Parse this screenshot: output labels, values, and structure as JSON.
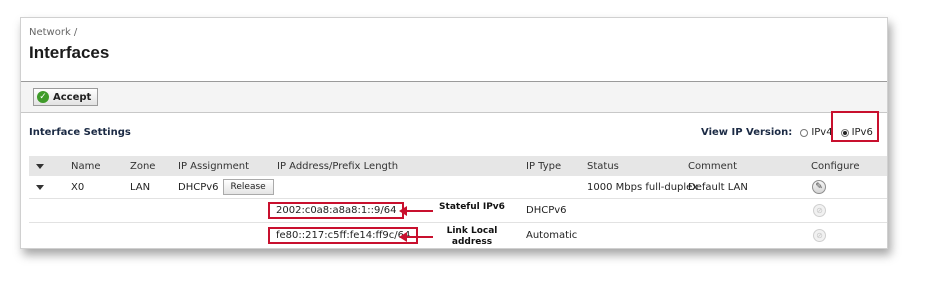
{
  "breadcrumb": "Network /",
  "title": "Interfaces",
  "toolbar": {
    "accept_label": "Accept"
  },
  "section_title": "Interface Settings",
  "ip_version": {
    "label": "View IP Version:",
    "options": [
      "IPv4",
      "IPv6"
    ],
    "selected": "IPv6"
  },
  "table": {
    "headers": [
      "Name",
      "Zone",
      "IP Assignment",
      "IP Address/Prefix Length",
      "IP Type",
      "Status",
      "Comment",
      "Configure"
    ],
    "interface_row": {
      "name": "X0",
      "zone": "LAN",
      "ip_assignment": "DHCPv6",
      "release_label": "Release",
      "status": "1000 Mbps full-duplex",
      "comment": "Default LAN"
    },
    "address_rows": [
      {
        "address": "2002:c0a8:a8a8:1::9/64",
        "ip_type": "DHCPv6"
      },
      {
        "address": "fe80::217:c5ff:fe14:ff9c/64",
        "ip_type": "Automatic"
      }
    ]
  },
  "annotations": {
    "stateful": "Stateful IPv6",
    "link_local": [
      "Link Local",
      "address"
    ]
  },
  "colors": {
    "highlight": "#c8102e",
    "accept_green": "#3f9b2a"
  },
  "icons": {
    "accept": "check-circle-icon",
    "configure": "pencil-icon",
    "configure_disabled": "disabled-configure-icon",
    "expand": "chevron-down-icon"
  }
}
